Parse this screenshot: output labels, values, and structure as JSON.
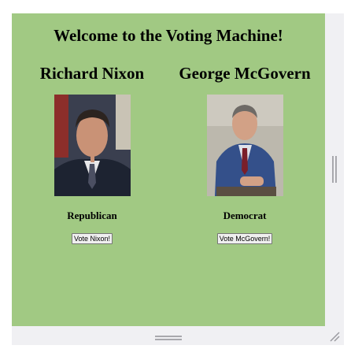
{
  "page": {
    "title": "Welcome to the Voting Machine!"
  },
  "candidates": [
    {
      "name": "Richard Nixon",
      "party": "Republican",
      "vote_label": "Vote Nixon!",
      "photo": "nixon-portrait"
    },
    {
      "name": "George McGovern",
      "party": "Democrat",
      "vote_label": "Vote McGovern!",
      "photo": "mcgovern-portrait"
    }
  ],
  "colors": {
    "panel_bg": "#a1c983",
    "frame_bg": "#f0f0f3"
  }
}
